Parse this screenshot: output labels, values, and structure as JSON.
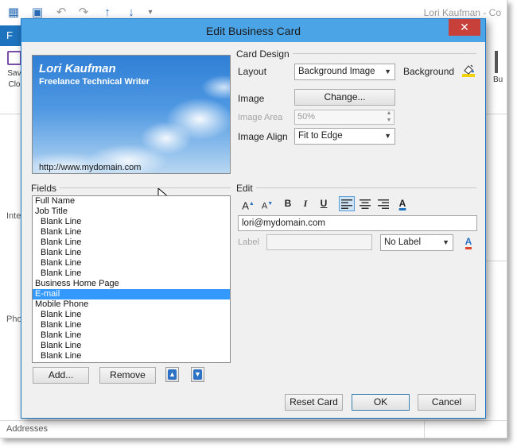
{
  "background_window": {
    "title": "Lori Kaufman - Co",
    "file_tab": "F",
    "save_close_label_1": "Sav",
    "save_close_label_2": "Clo",
    "business_label": "Bu",
    "side_labels": {
      "internet": "Inte",
      "phone": "Pho",
      "addresses": "Addresses"
    }
  },
  "dialog": {
    "title": "Edit Business Card",
    "close_glyph": "✕"
  },
  "card": {
    "name": "Lori Kaufman",
    "job_title": "Freelance Technical Writer",
    "url": "http://www.mydomain.com"
  },
  "card_design": {
    "section_label": "Card Design",
    "layout_label": "Layout",
    "layout_value": "Background Image",
    "background_label": "Background",
    "image_label": "Image",
    "change_button": "Change...",
    "image_area_label": "Image Area",
    "image_area_value": "50%",
    "image_align_label": "Image Align",
    "image_align_value": "Fit to Edge"
  },
  "fields": {
    "section_label": "Fields",
    "items": [
      {
        "label": "Full Name",
        "sub": false,
        "selected": false
      },
      {
        "label": "Job Title",
        "sub": false,
        "selected": false
      },
      {
        "label": "Blank Line",
        "sub": true,
        "selected": false
      },
      {
        "label": "Blank Line",
        "sub": true,
        "selected": false
      },
      {
        "label": "Blank Line",
        "sub": true,
        "selected": false
      },
      {
        "label": "Blank Line",
        "sub": true,
        "selected": false
      },
      {
        "label": "Blank Line",
        "sub": true,
        "selected": false
      },
      {
        "label": "Blank Line",
        "sub": true,
        "selected": false
      },
      {
        "label": "Business Home Page",
        "sub": false,
        "selected": false
      },
      {
        "label": "E-mail",
        "sub": false,
        "selected": true
      },
      {
        "label": "Mobile Phone",
        "sub": false,
        "selected": false
      },
      {
        "label": "Blank Line",
        "sub": true,
        "selected": false
      },
      {
        "label": "Blank Line",
        "sub": true,
        "selected": false
      },
      {
        "label": "Blank Line",
        "sub": true,
        "selected": false
      },
      {
        "label": "Blank Line",
        "sub": true,
        "selected": false
      },
      {
        "label": "Blank Line",
        "sub": true,
        "selected": false
      }
    ],
    "add_button": "Add...",
    "remove_button": "Remove"
  },
  "edit": {
    "section_label": "Edit",
    "toolbar": {
      "increase_font": "A",
      "decrease_font": "A",
      "bold": "B",
      "italic": "I",
      "underline": "U",
      "font_color": "A"
    },
    "value": "lori@mydomain.com",
    "label_label": "Label",
    "label_value": "",
    "label_position": "No Label",
    "label_color_glyph": "A"
  },
  "footer": {
    "reset_button": "Reset Card",
    "ok_button": "OK",
    "cancel_button": "Cancel"
  },
  "colors": {
    "accent": "#1e73be",
    "dialog_title_bar": "#4aa4e6",
    "close_button": "#c7403a",
    "selection": "#3399ff"
  }
}
